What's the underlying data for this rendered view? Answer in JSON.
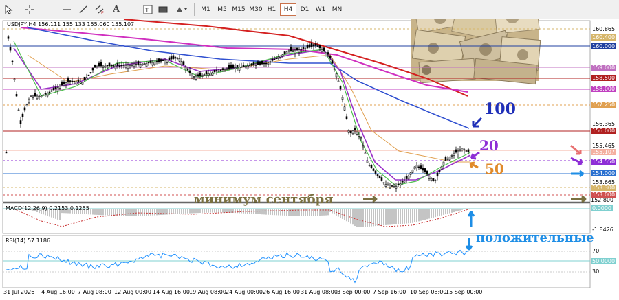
{
  "toolbar": {
    "icons": [
      "cursor-icon",
      "crosshair-icon",
      "hline-icon",
      "trendline-icon",
      "equidistant-channel-icon",
      "text-icon",
      "label-icon",
      "rectangle-icon",
      "shapes-dropdown-icon"
    ],
    "timeframes": [
      "M1",
      "M5",
      "M15",
      "M30",
      "H1",
      "H4",
      "D1",
      "W1",
      "MN"
    ],
    "active_timeframe": "H4"
  },
  "chart": {
    "header": "USDJPY,H4  156.111 155.133 155.060 155.107",
    "price_scale": [
      "160.865",
      "160.400",
      "160.000",
      "159.000",
      "158.500",
      "158.000",
      "157.250",
      "156.365",
      "156.000",
      "155.465",
      "155.107",
      "154.550",
      "154.000",
      "153.665",
      "153.300",
      "153.000",
      "152.800"
    ],
    "time_labels": [
      "31 Jul 2026",
      "4 Aug 16:00",
      "7 Aug 08:00",
      "12 Aug 00:00",
      "14 Aug 16:00",
      "19 Aug 08:00",
      "24 Aug 00:00",
      "26 Aug 16:00",
      "31 Aug 08:00",
      "3 Sep 00:00",
      "7 Sep 16:00",
      "10 Sep 08:00",
      "15 Sep 00:00"
    ],
    "annotations": {
      "ma100": "100",
      "ma20": "20",
      "ma50": "50",
      "september_low": "минимум сентября",
      "positive": "положительные"
    }
  },
  "macd": {
    "header": "MACD(12,26,9) 0.2153 0.1255",
    "scale": [
      "0.0000",
      "-1.8426"
    ]
  },
  "rsi": {
    "header": "RSI(14) 57.1186",
    "scale": [
      "70",
      "50.0000",
      "30"
    ]
  },
  "colors": {
    "background": "#ffffff",
    "candle": "#000000",
    "ma20": "#9a32c8",
    "ma50": "#e0a050",
    "ma100": "#3050d0",
    "ma200": "#d42020",
    "ma_magenta": "#d030c0",
    "rsi_line": "#1e90ff",
    "macd_signal": "#c83030",
    "annotation_olive": "#7a7040",
    "annotation_blue": "#1f2fb8",
    "annotation_purple": "#8e2ed6",
    "annotation_orange": "#e08a2a",
    "annotation_cyan": "#1e8ee6"
  }
}
